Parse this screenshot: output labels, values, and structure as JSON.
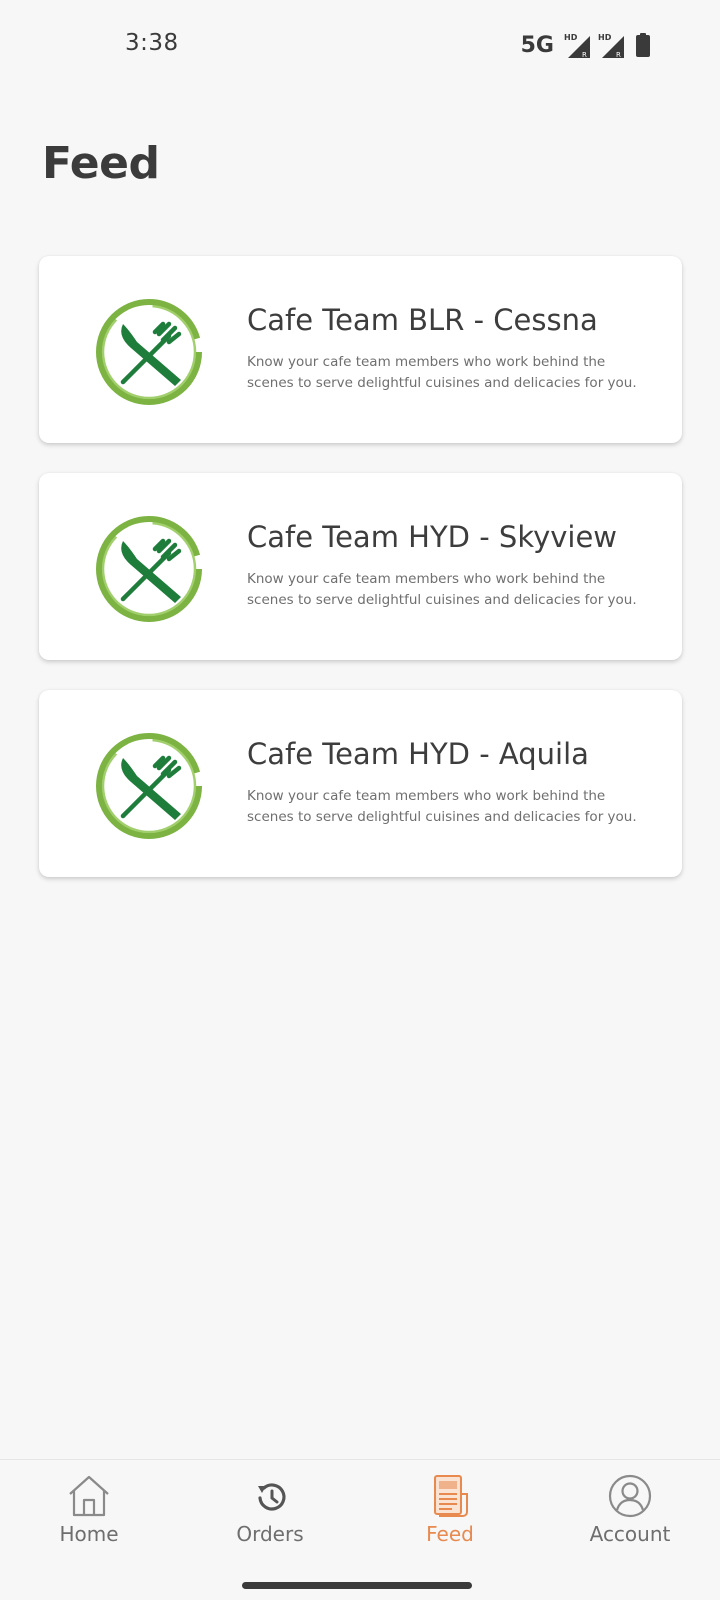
{
  "status_bar": {
    "time": "3:38",
    "network": "5G",
    "signal_icons": [
      "signal-hd-icon",
      "signal-hd-icon"
    ],
    "battery_icon": "battery-icon"
  },
  "page": {
    "title": "Feed"
  },
  "feed": {
    "items": [
      {
        "title": "Cafe Team BLR - Cessna",
        "description": "Know your cafe team members who work behind the scenes to serve delightful cuisines and delicacies for you.",
        "icon": "fork-knife-icon"
      },
      {
        "title": "Cafe Team HYD - Skyview",
        "description": "Know your cafe team members who work behind the scenes to serve delightful cuisines and delicacies for you.",
        "icon": "fork-knife-icon"
      },
      {
        "title": "Cafe Team HYD - Aquila",
        "description": "Know your cafe team members who work behind the scenes to serve delightful cuisines and delicacies for you.",
        "icon": "fork-knife-icon"
      }
    ]
  },
  "bottom_nav": {
    "items": [
      {
        "label": "Home",
        "icon": "home-icon",
        "active": false
      },
      {
        "label": "Orders",
        "icon": "history-icon",
        "active": false
      },
      {
        "label": "Feed",
        "icon": "feed-icon",
        "active": true
      },
      {
        "label": "Account",
        "icon": "account-icon",
        "active": false
      }
    ]
  },
  "colors": {
    "accent": "#e88a4f",
    "logo_ring": "#7cb342",
    "logo_utensils": "#1e7d3a",
    "background": "#f7f7f7"
  }
}
